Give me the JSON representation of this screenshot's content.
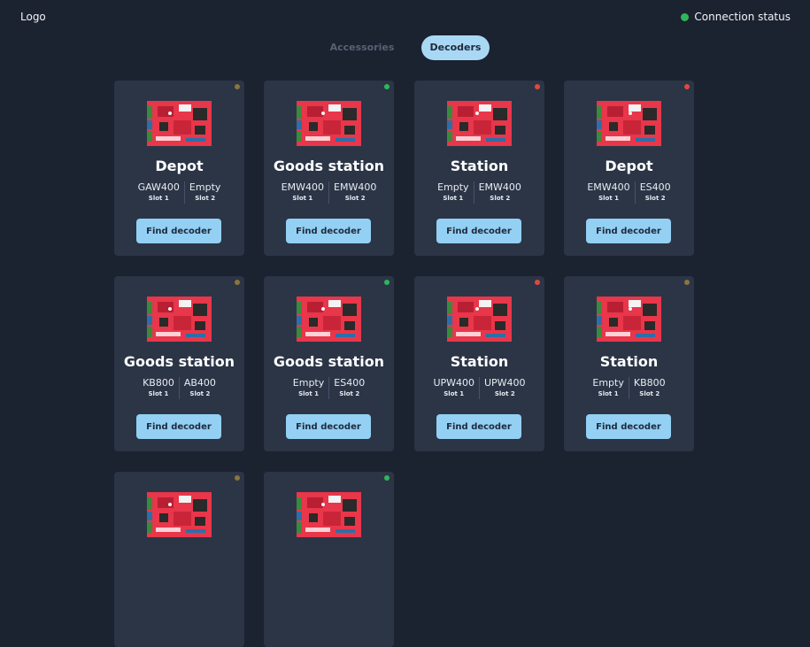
{
  "header": {
    "logo": "Logo",
    "connection_label": "Connection status",
    "connection_color": "#2fb65a"
  },
  "tabs": [
    {
      "label": "Accessories",
      "active": false
    },
    {
      "label": "Decoders",
      "active": true
    }
  ],
  "colors": {
    "background": "#1b2230",
    "card": "#2b3546",
    "accent": "#94cff4",
    "status_green": "#2fb65a",
    "status_red": "#e0483f",
    "status_amber": "#8a7440",
    "board_red": "#e8364a"
  },
  "decoders": [
    {
      "title": "Depot",
      "status": "amber",
      "slots": [
        {
          "value": "GAW400",
          "label": "Slot 1"
        },
        {
          "value": "Empty",
          "label": "Slot 2"
        }
      ],
      "button": "Find decoder"
    },
    {
      "title": "Goods station",
      "status": "green",
      "slots": [
        {
          "value": "EMW400",
          "label": "Slot 1"
        },
        {
          "value": "EMW400",
          "label": "Slot 2"
        }
      ],
      "button": "Find decoder"
    },
    {
      "title": "Station",
      "status": "red",
      "slots": [
        {
          "value": "Empty",
          "label": "Slot 1"
        },
        {
          "value": "EMW400",
          "label": "Slot 2"
        }
      ],
      "button": "Find decoder"
    },
    {
      "title": "Depot",
      "status": "red",
      "slots": [
        {
          "value": "EMW400",
          "label": "Slot 1"
        },
        {
          "value": "ES400",
          "label": "Slot 2"
        }
      ],
      "button": "Find decoder"
    },
    {
      "title": "Goods station",
      "status": "amber",
      "slots": [
        {
          "value": "KB800",
          "label": "Slot 1"
        },
        {
          "value": "AB400",
          "label": "Slot 2"
        }
      ],
      "button": "Find decoder"
    },
    {
      "title": "Goods station",
      "status": "green",
      "slots": [
        {
          "value": "Empty",
          "label": "Slot 1"
        },
        {
          "value": "ES400",
          "label": "Slot 2"
        }
      ],
      "button": "Find decoder"
    },
    {
      "title": "Station",
      "status": "red",
      "slots": [
        {
          "value": "UPW400",
          "label": "Slot 1"
        },
        {
          "value": "UPW400",
          "label": "Slot 2"
        }
      ],
      "button": "Find decoder"
    },
    {
      "title": "Station",
      "status": "amber",
      "slots": [
        {
          "value": "Empty",
          "label": "Slot 1"
        },
        {
          "value": "KB800",
          "label": "Slot 2"
        }
      ],
      "button": "Find decoder"
    },
    {
      "title": "",
      "status": "amber",
      "slots": [],
      "button": ""
    },
    {
      "title": "",
      "status": "green",
      "slots": [],
      "button": ""
    }
  ]
}
